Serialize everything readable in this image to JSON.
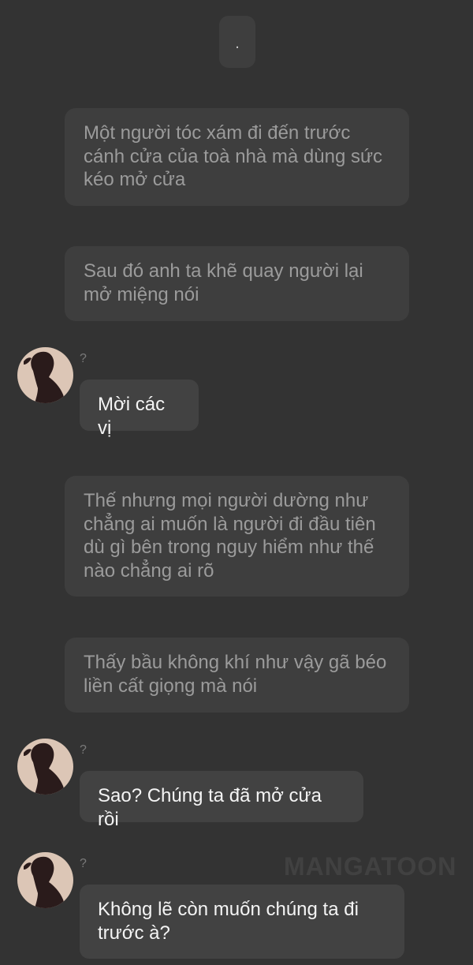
{
  "top_marker": ".",
  "narrations": [
    "Một người tóc xám đi đến trước cánh cửa của toà nhà mà dùng sức kéo mở cửa",
    "Sau đó anh ta khẽ quay người lại mở miệng nói",
    "Thế nhưng mọi người dường như chẳng ai muốn là người đi đầu tiên dù gì bên trong nguy hiểm như thế nào chẳng ai rõ",
    "Thấy bầu không khí như vậy gã béo liền cất giọng mà nói"
  ],
  "dialogues": [
    {
      "speaker": "?",
      "text": "Mời các vị",
      "avatar_icon": "silhouette-avatar-icon"
    },
    {
      "speaker": "?",
      "text": "Sao? Chúng ta đã mở cửa rồi",
      "avatar_icon": "silhouette-avatar-icon"
    },
    {
      "speaker": "?",
      "text": "Không lẽ còn muốn chúng ta đi trước à?",
      "avatar_icon": "silhouette-avatar-icon"
    }
  ],
  "watermark": "MANGATOON",
  "colors": {
    "background": "#333333",
    "narration_bubble": "#3e3e3e",
    "narration_text": "#9b9b9b",
    "speech_bubble": "#424242",
    "speech_text": "#f4f4f4",
    "avatar_bg": "#dcc6b6",
    "avatar_silhouette": "#2a1b1b"
  }
}
